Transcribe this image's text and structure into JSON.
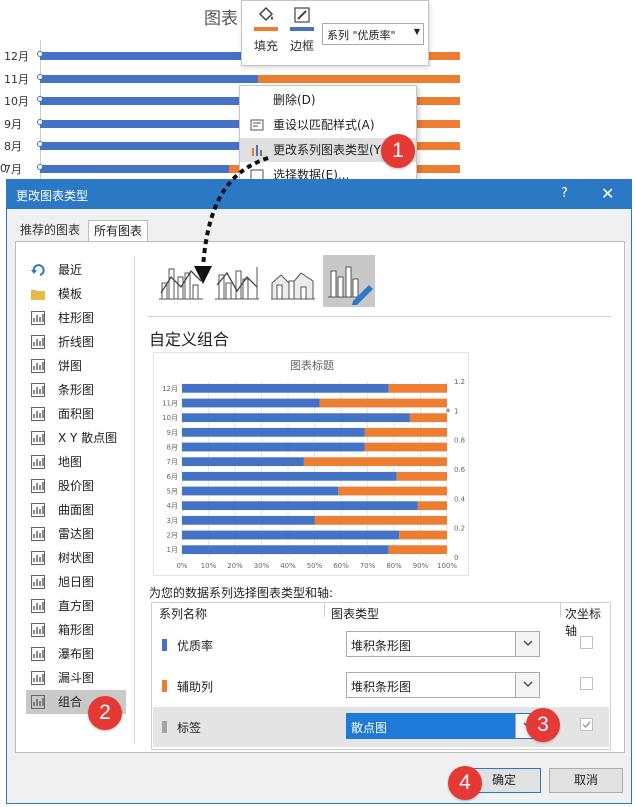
{
  "background": {
    "chart_title": "图表",
    "rows": [
      {
        "label": "12月",
        "blue": 0.78
      },
      {
        "label": "11月",
        "blue": 0.52
      },
      {
        "label": "10月",
        "blue": 0.86
      },
      {
        "label": "9月",
        "blue": 0.69
      },
      {
        "label": "8月",
        "blue": 0.7
      },
      {
        "label": "7月",
        "blue": 0.45
      }
    ],
    "left_stub": "0"
  },
  "format_toolbar": {
    "fill_label": "填充",
    "border_label": "边框",
    "series_select": "系列 \"优质率\"",
    "fill_color": "#ed7d31",
    "border_color": "#4472c4"
  },
  "context_menu": {
    "items": [
      {
        "label": "删除(D)",
        "icon": ""
      },
      {
        "label": "重设以匹配样式(A)",
        "icon": "reset-style-icon"
      },
      {
        "label": "更改系列图表类型(Y)...",
        "icon": "chart-type-icon"
      },
      {
        "label": "选择数据(E)...",
        "icon": "select-data-icon"
      }
    ]
  },
  "badges": [
    "1",
    "2",
    "3",
    "4"
  ],
  "dialog": {
    "title": "更改图表类型",
    "help": "?",
    "close": "✕",
    "tabs": [
      "推荐的图表",
      "所有图表"
    ],
    "nav_items": [
      "最近",
      "模板",
      "柱形图",
      "折线图",
      "饼图",
      "条形图",
      "面积图",
      "X Y 散点图",
      "地图",
      "股价图",
      "曲面图",
      "雷达图",
      "树状图",
      "旭日图",
      "直方图",
      "箱形图",
      "瀑布图",
      "漏斗图",
      "组合"
    ],
    "section_title": "自定义组合",
    "assign_label": "为您的数据系列选择图表类型和轴:",
    "table_headers": {
      "name": "系列名称",
      "type": "图表类型",
      "secondary": "次坐标轴"
    },
    "series": [
      {
        "name": "优质率",
        "type": "堆积条形图",
        "color": "#4472c4",
        "secondary": false
      },
      {
        "name": "辅助列",
        "type": "堆积条形图",
        "color": "#ed7d31",
        "secondary": false
      },
      {
        "name": "标签",
        "type": "散点图",
        "color": "#a5a5a5",
        "secondary": true
      }
    ],
    "ok_label": "确定",
    "cancel_label": "取消"
  },
  "chart_data": {
    "type": "bar",
    "title": "图表标题",
    "categories": [
      "1月",
      "2月",
      "3月",
      "4月",
      "5月",
      "6月",
      "7月",
      "8月",
      "9月",
      "10月",
      "11月",
      "12月"
    ],
    "series": [
      {
        "name": "优质率",
        "values": [
          0.78,
          0.82,
          0.5,
          0.89,
          0.59,
          0.81,
          0.46,
          0.69,
          0.69,
          0.86,
          0.52,
          0.78
        ],
        "color": "#4472c4"
      },
      {
        "name": "辅助列",
        "values": [
          0.22,
          0.18,
          0.5,
          0.11,
          0.41,
          0.19,
          0.54,
          0.31,
          0.31,
          0.14,
          0.48,
          0.22
        ],
        "color": "#ed7d31"
      }
    ],
    "x_ticks": [
      "0%",
      "10%",
      "20%",
      "30%",
      "40%",
      "50%",
      "60%",
      "70%",
      "80%",
      "90%",
      "100%"
    ],
    "y2_ticks": [
      "0",
      "0.2",
      "0.4",
      "0.6",
      "0.8",
      "1",
      "1.2"
    ],
    "xlim": [
      0,
      1
    ],
    "y2lim": [
      0,
      1.2
    ],
    "stacked": true,
    "grid": true
  }
}
